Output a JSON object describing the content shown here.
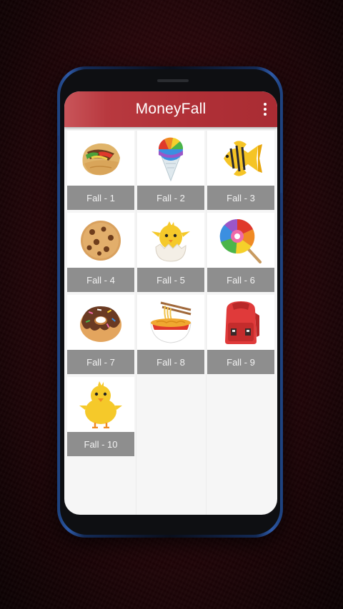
{
  "app": {
    "title": "MoneyFall"
  },
  "items": [
    {
      "label": "Fall - 1",
      "icon": "burrito-icon"
    },
    {
      "label": "Fall - 2",
      "icon": "shaved-ice-icon"
    },
    {
      "label": "Fall - 3",
      "icon": "tropical-fish-icon"
    },
    {
      "label": "Fall - 4",
      "icon": "cookie-icon"
    },
    {
      "label": "Fall - 5",
      "icon": "hatching-chick-icon"
    },
    {
      "label": "Fall - 6",
      "icon": "lollipop-icon"
    },
    {
      "label": "Fall - 7",
      "icon": "doughnut-icon"
    },
    {
      "label": "Fall - 8",
      "icon": "noodle-bowl-icon"
    },
    {
      "label": "Fall - 9",
      "icon": "backpack-icon"
    },
    {
      "label": "Fall - 10",
      "icon": "chick-icon"
    }
  ],
  "colors": {
    "appbar": "#b03037",
    "label_bg": "#8e8e8e",
    "screen_bg": "#f6f6f6"
  }
}
